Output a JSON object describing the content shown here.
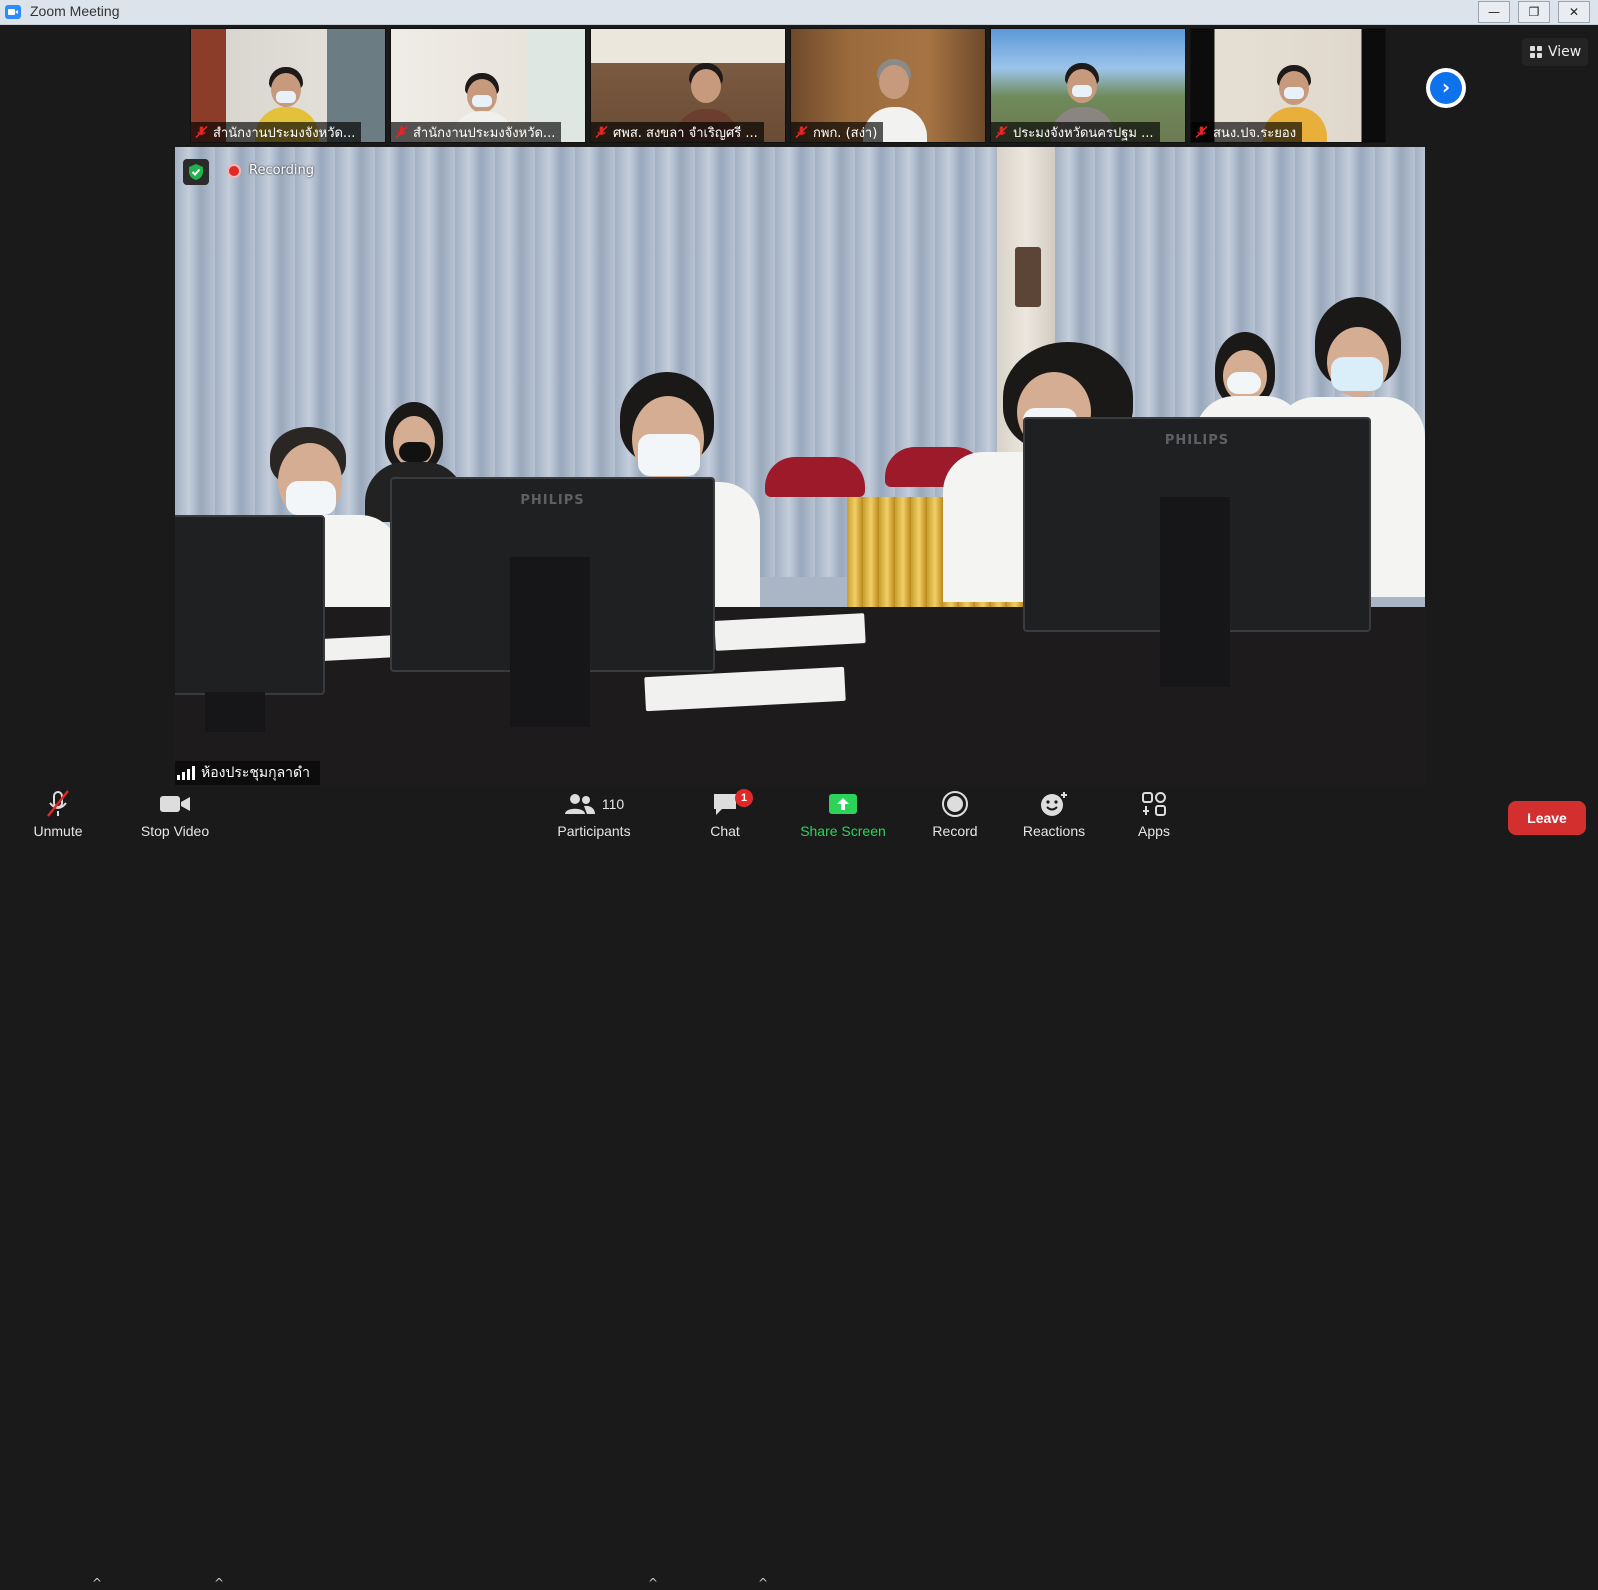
{
  "window": {
    "title": "Zoom Meeting",
    "minimize_glyph": "—",
    "maximize_glyph": "❐",
    "close_glyph": "✕"
  },
  "view_button": {
    "label": "View"
  },
  "thumbnails": [
    {
      "name": "สำนักงานประมงจังหวัด...",
      "muted": true
    },
    {
      "name": "สำนักงานประมงจังหวัด...",
      "muted": true
    },
    {
      "name": "ศพส. สงขลา จำเริญศรี ...",
      "muted": true
    },
    {
      "name": "กพก. (สง่า)",
      "muted": true
    },
    {
      "name": "ประมงจังหวัดนครปฐม ...",
      "muted": true
    },
    {
      "name": "สนง.ปจ.ระยอง",
      "muted": true
    }
  ],
  "next_page_glyph": "›",
  "main_video": {
    "recording_label": "Recording",
    "speaker_name": "ห้องประชุมกุลาดำ",
    "monitor_brand": "PHILIPS"
  },
  "toolbar": {
    "unmute_label": "Unmute",
    "stop_video_label": "Stop Video",
    "participants_label": "Participants",
    "participants_count": "110",
    "chat_label": "Chat",
    "chat_unread": "1",
    "share_screen_label": "Share Screen",
    "record_label": "Record",
    "reactions_label": "Reactions",
    "apps_label": "Apps",
    "leave_label": "Leave",
    "caret_glyph": "^"
  },
  "colors": {
    "accent_blue": "#0e72ed",
    "share_green": "#2dd25a",
    "leave_red": "#d42f2f",
    "mute_red": "#e02828"
  }
}
